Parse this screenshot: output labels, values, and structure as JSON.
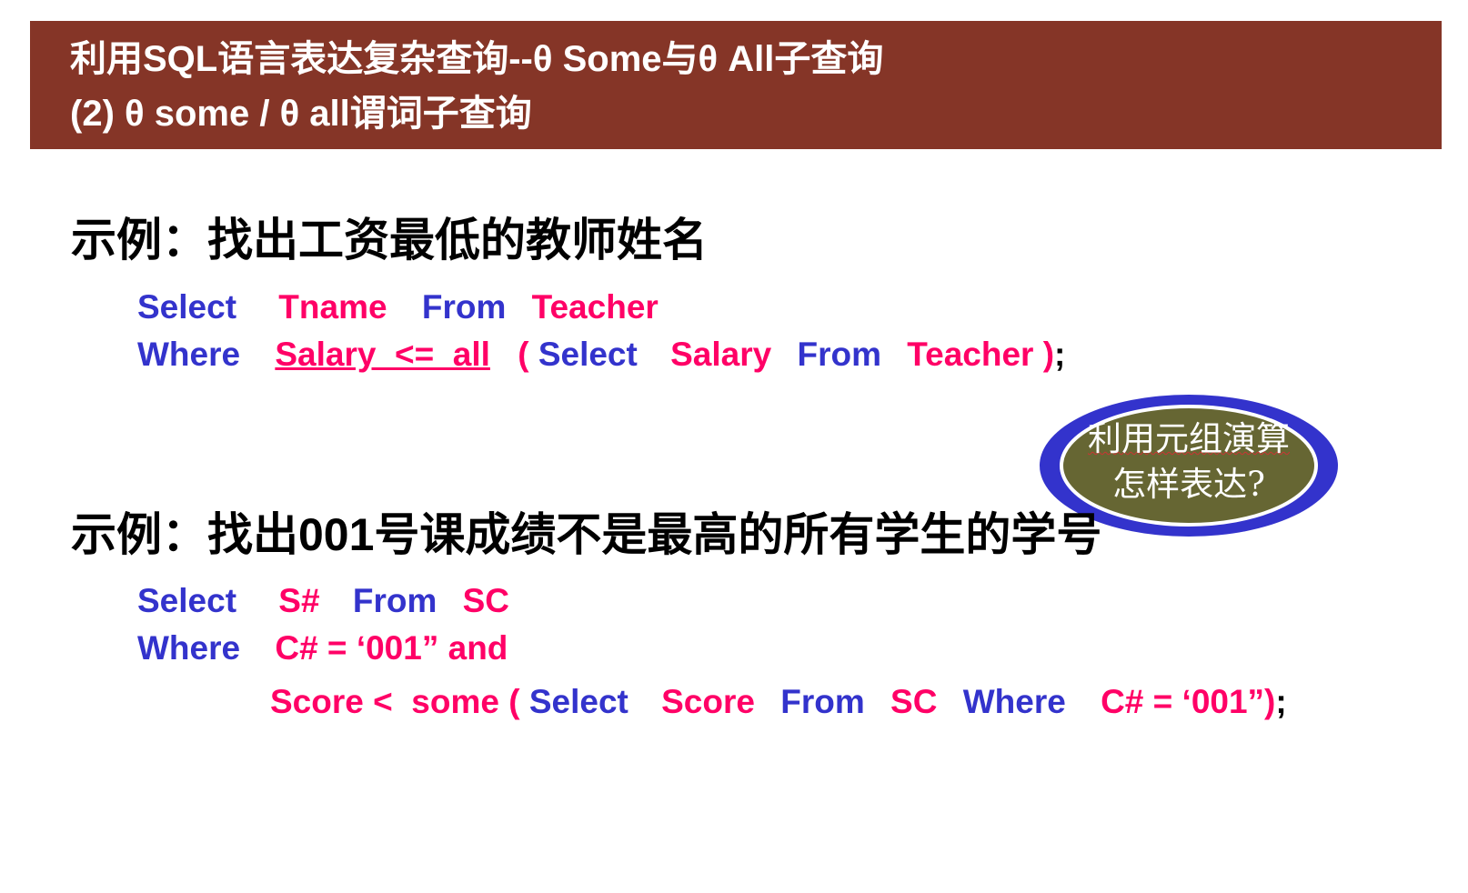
{
  "header": {
    "line1": "利用SQL语言表达复杂查询--θ Some与θ All子查询",
    "line2": "(2) θ some / θ all谓词子查询"
  },
  "example1": {
    "title": "示例：找出工资最低的教师姓名",
    "row1": {
      "select": "Select",
      "col": "Tname",
      "from": "From",
      "table": "Teacher"
    },
    "row2": {
      "where": "Where",
      "cond": "Salary  <=  all",
      "paren": "(",
      "select": "Select",
      "col": "Salary",
      "from": "From",
      "table": "Teacher )",
      "semi": ";"
    }
  },
  "bubble": {
    "line1": "利用元组演算",
    "line2": "怎样表达?",
    "colors": {
      "ring": "#3333cc",
      "fill": "#666633"
    }
  },
  "example2": {
    "title": "示例：找出001号课成绩不是最高的所有学生的学号",
    "row1": {
      "select": "Select",
      "col": "S#",
      "from": "From",
      "table": "SC"
    },
    "row2": {
      "where": "Where",
      "cond": "C# = ‘001” and"
    },
    "row3": {
      "cond": "Score <  some (",
      "select": "Select",
      "col": "Score",
      "from": "From",
      "table": "SC",
      "where": "Where",
      "cond2": "C# = ‘001”)",
      "semi": ";"
    }
  },
  "colors": {
    "header_bg": "#853527",
    "keyword": "#3333cc",
    "identifier": "#ff0066"
  }
}
